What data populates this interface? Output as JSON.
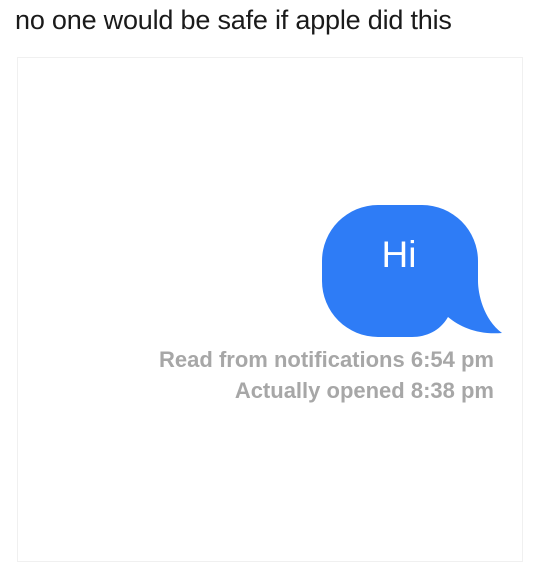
{
  "caption": "no one would be safe if apple did this",
  "message": {
    "text": "Hi",
    "bubble_color": "#2e7cf6",
    "text_color": "#ffffff"
  },
  "status": {
    "line1": "Read from notifications 6:54 pm",
    "line2": "Actually opened 8:38 pm",
    "color": "#a7a7a7"
  }
}
